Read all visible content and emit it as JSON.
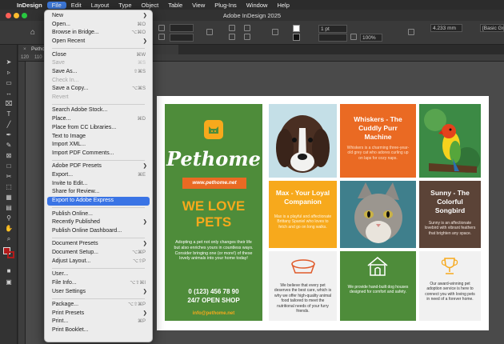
{
  "menubar": {
    "app_name": "InDesign",
    "items": [
      "File",
      "Edit",
      "Layout",
      "Type",
      "Object",
      "Table",
      "View",
      "Plug-Ins",
      "Window",
      "Help"
    ],
    "active_item": "File"
  },
  "window": {
    "title": "Adobe InDesign 2025"
  },
  "control_bar": {
    "stroke_weight": "1 pt",
    "zoom_percent": "100%",
    "width_value": "4.233 mm",
    "style_name": "[Basic Graph"
  },
  "document_tab": {
    "name": "Pethom"
  },
  "ruler": {
    "ticks": [
      "120",
      "110",
      "100"
    ]
  },
  "file_menu": {
    "groups": [
      [
        {
          "label": "New",
          "shortcut": "",
          "submenu": true,
          "disabled": false
        },
        {
          "label": "Open...",
          "shortcut": "⌘O",
          "submenu": false,
          "disabled": false
        },
        {
          "label": "Browse in Bridge...",
          "shortcut": "⌥⌘O",
          "submenu": false,
          "disabled": false
        },
        {
          "label": "Open Recent",
          "shortcut": "",
          "submenu": true,
          "disabled": false
        }
      ],
      [
        {
          "label": "Close",
          "shortcut": "⌘W",
          "submenu": false,
          "disabled": false
        },
        {
          "label": "Save",
          "shortcut": "⌘S",
          "submenu": false,
          "disabled": true
        },
        {
          "label": "Save As...",
          "shortcut": "⇧⌘S",
          "submenu": false,
          "disabled": false
        },
        {
          "label": "Check In...",
          "shortcut": "",
          "submenu": false,
          "disabled": true
        },
        {
          "label": "Save a Copy...",
          "shortcut": "⌥⌘S",
          "submenu": false,
          "disabled": false
        },
        {
          "label": "Revert",
          "shortcut": "",
          "submenu": false,
          "disabled": true
        }
      ],
      [
        {
          "label": "Search Adobe Stock...",
          "shortcut": "",
          "submenu": false,
          "disabled": false
        },
        {
          "label": "Place...",
          "shortcut": "⌘D",
          "submenu": false,
          "disabled": false
        },
        {
          "label": "Place from CC Libraries...",
          "shortcut": "",
          "submenu": false,
          "disabled": false
        },
        {
          "label": "Text to Image",
          "shortcut": "",
          "submenu": false,
          "disabled": false
        },
        {
          "label": "Import XML...",
          "shortcut": "",
          "submenu": false,
          "disabled": false
        },
        {
          "label": "Import PDF Comments...",
          "shortcut": "",
          "submenu": false,
          "disabled": false
        }
      ],
      [
        {
          "label": "Adobe PDF Presets",
          "shortcut": "",
          "submenu": true,
          "disabled": false
        },
        {
          "label": "Export...",
          "shortcut": "⌘E",
          "submenu": false,
          "disabled": false
        },
        {
          "label": "Invite to Edit...",
          "shortcut": "",
          "submenu": false,
          "disabled": false
        },
        {
          "label": "Share for Review...",
          "shortcut": "",
          "submenu": false,
          "disabled": false
        },
        {
          "label": "Export to Adobe Express",
          "shortcut": "",
          "submenu": false,
          "disabled": false,
          "highlighted": true
        }
      ],
      [
        {
          "label": "Publish Online...",
          "shortcut": "",
          "submenu": false,
          "disabled": false
        },
        {
          "label": "Recently Published",
          "shortcut": "",
          "submenu": true,
          "disabled": false
        },
        {
          "label": "Publish Online Dashboard...",
          "shortcut": "",
          "submenu": false,
          "disabled": false
        }
      ],
      [
        {
          "label": "Document Presets",
          "shortcut": "",
          "submenu": true,
          "disabled": false
        },
        {
          "label": "Document Setup...",
          "shortcut": "⌥⌘P",
          "submenu": false,
          "disabled": false
        },
        {
          "label": "Adjust Layout...",
          "shortcut": "⌥⇧P",
          "submenu": false,
          "disabled": false
        }
      ],
      [
        {
          "label": "User...",
          "shortcut": "",
          "submenu": false,
          "disabled": false
        },
        {
          "label": "File Info...",
          "shortcut": "⌥⇧⌘I",
          "submenu": false,
          "disabled": false
        },
        {
          "label": "User Settings",
          "shortcut": "",
          "submenu": true,
          "disabled": false
        }
      ],
      [
        {
          "label": "Package...",
          "shortcut": "⌥⇧⌘P",
          "submenu": false,
          "disabled": false
        },
        {
          "label": "Print Presets",
          "shortcut": "",
          "submenu": true,
          "disabled": false
        },
        {
          "label": "Print...",
          "shortcut": "⌘P",
          "submenu": false,
          "disabled": false
        },
        {
          "label": "Print Booklet...",
          "shortcut": "",
          "submenu": false,
          "disabled": false
        }
      ]
    ]
  },
  "flyer": {
    "brand": "Pethome",
    "website": "www.pethome.net",
    "headline": "WE LOVE PETS",
    "intro": "Adopting a pet not only changes their life but also enriches yours in countless ways. Consider bringing one (or more!) of these lovely animals into your home today!",
    "phone": "0 (123) 456 78 90",
    "hours": "24/7 OPEN SHOP",
    "email": "info@pethome.net",
    "whiskers_title": "Whiskers - The Cuddly Purr Machine",
    "whiskers_text": "Whiskers is a charming three-year-old grey cat who adores curling up on laps for cozy naps.",
    "max_title": "Max - Your Loyal Companion",
    "max_text": "Max is a playful and affectionate Brittany Spaniel who loves to fetch and go on long walks.",
    "sunny_title": "Sunny - The Colorful Songbird",
    "sunny_text": "Sunny is an affectionate lovebird with vibrant feathers that brighten any space.",
    "food_text": "We believe that every pet deserves the best care, which is why we offer high-quality animal food tailored to meet the nutritional needs of your furry friends.",
    "house_text": "We provide hand-built dog houses designed for comfort and safety.",
    "award_text": "Our award-winning pet adoption service is here to connect you with loving pets in need of a forever home."
  },
  "colors": {
    "green": "#4e8c3a",
    "orange": "#ea6a23",
    "yellow": "#f7a91c",
    "teal": "#3f7f8c",
    "brown": "#5b4337",
    "menu_highlight": "#3a74e5"
  }
}
